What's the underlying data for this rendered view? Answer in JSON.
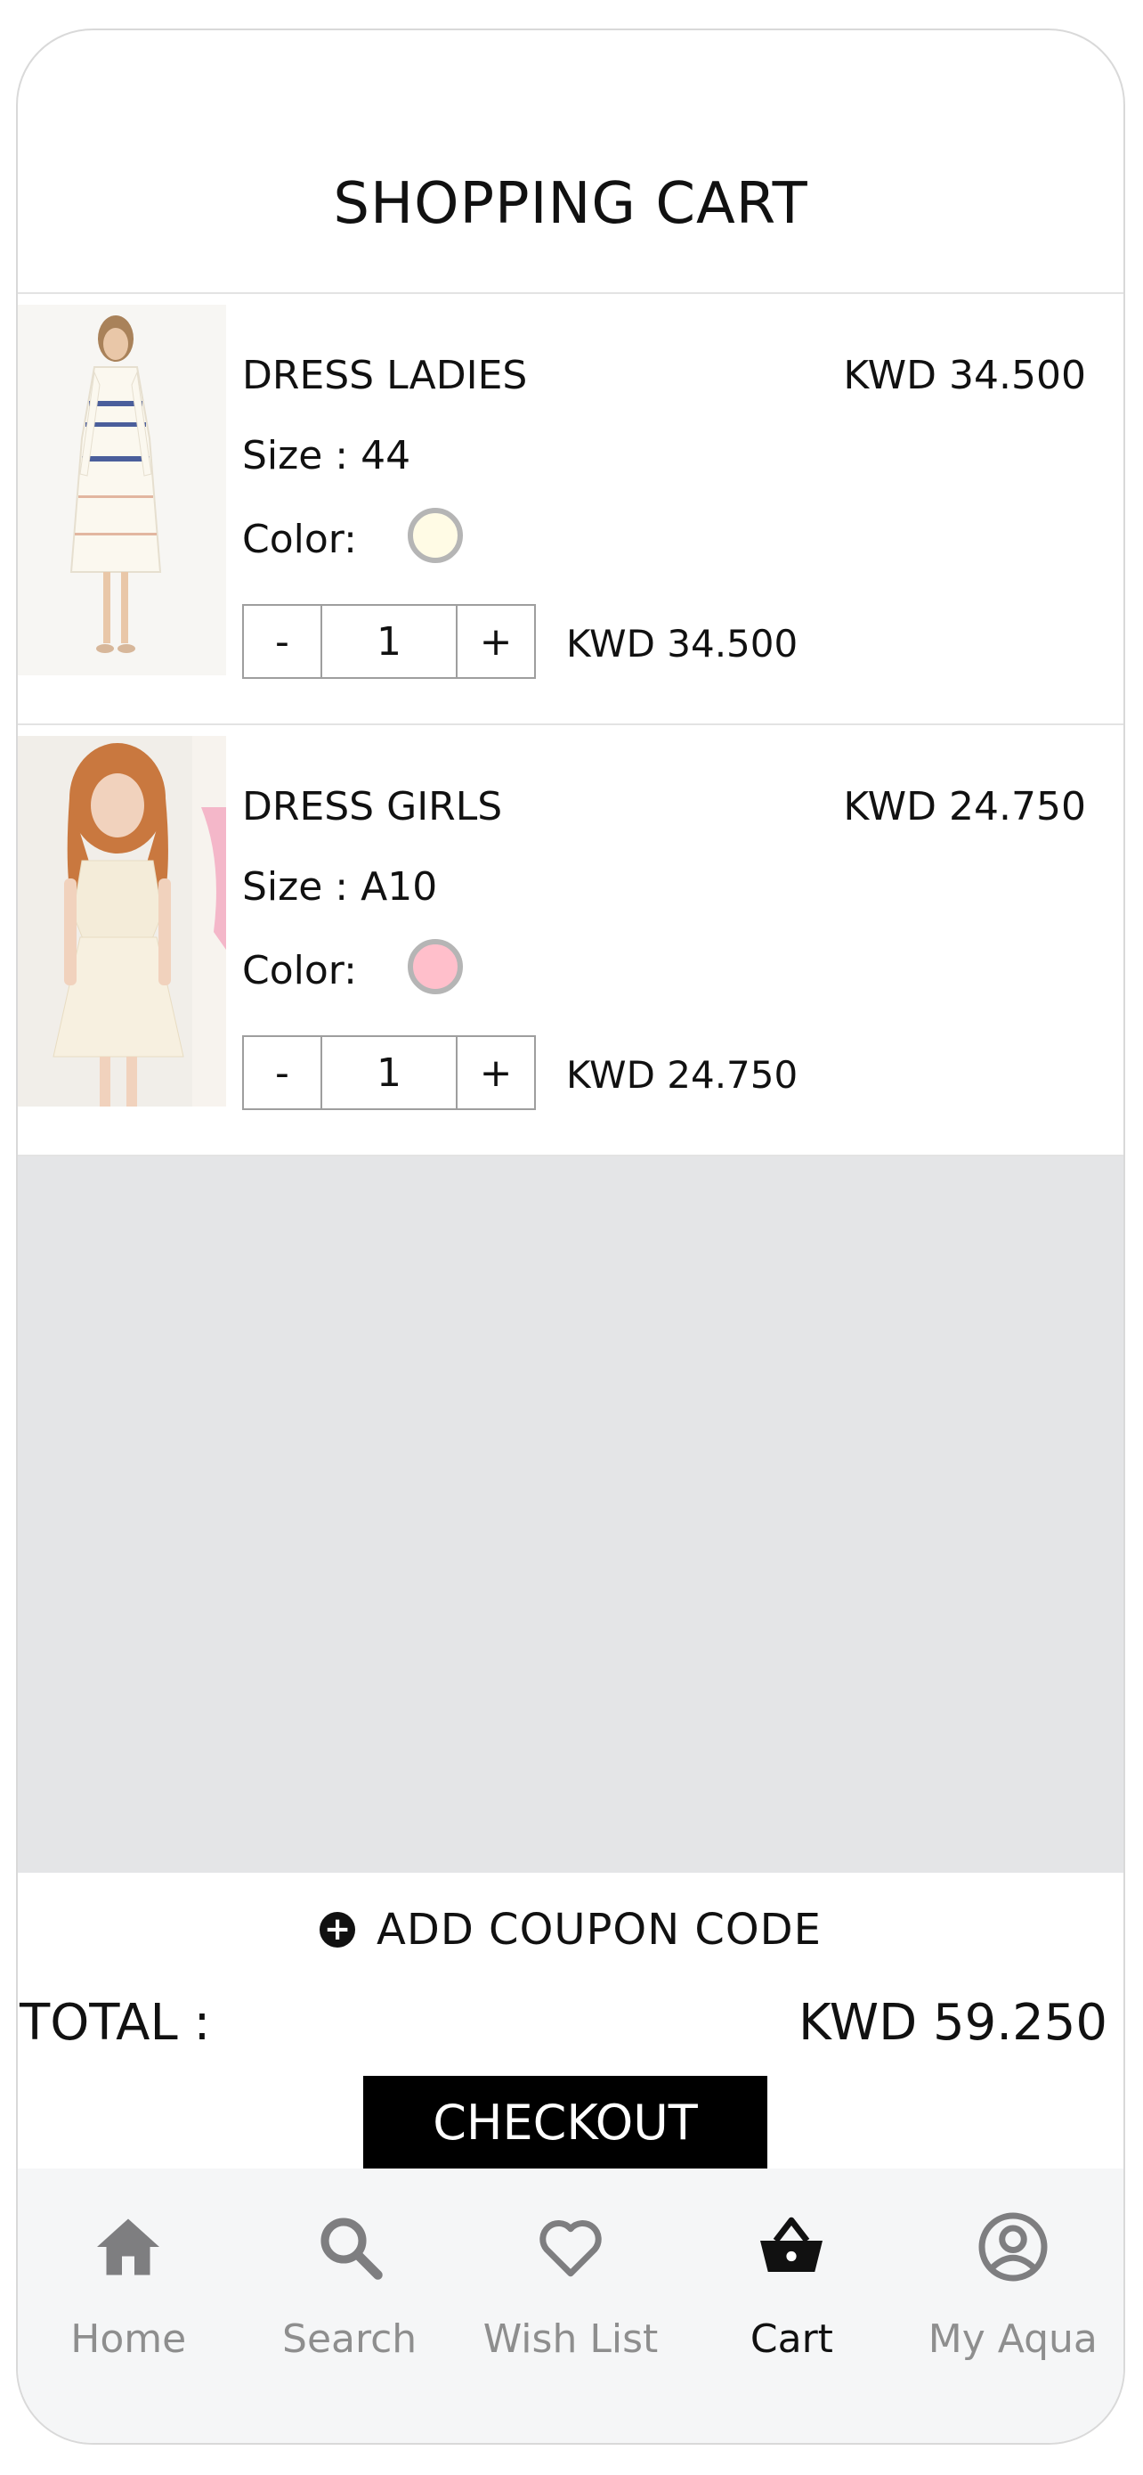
{
  "header": {
    "title": "SHOPPING CART"
  },
  "cart": {
    "items": [
      {
        "name": "DRESS LADIES",
        "price": "KWD 34.500",
        "size": "Size : 44",
        "color_label": "Color:",
        "color_hex": "#fffbe5",
        "qty_minus": "-",
        "quantity": "1",
        "qty_plus": "+",
        "line_total": "KWD 34.500"
      },
      {
        "name": "DRESS GIRLS",
        "price": "KWD 24.750",
        "size": "Size : A10",
        "color_label": "Color:",
        "color_hex": "#ffbfcb",
        "qty_minus": "-",
        "quantity": "1",
        "qty_plus": "+",
        "line_total": "KWD 24.750"
      }
    ]
  },
  "coupon": {
    "label": "ADD COUPON CODE",
    "icon": "plus-circle-icon"
  },
  "summary": {
    "total_label": "TOTAL :",
    "total_value": "KWD 59.250"
  },
  "checkout": {
    "label": "CHECKOUT"
  },
  "tabbar": {
    "tabs": [
      {
        "label": "Home",
        "icon": "home-icon"
      },
      {
        "label": "Search",
        "icon": "search-icon"
      },
      {
        "label": "Wish List",
        "icon": "heart-icon"
      },
      {
        "label": "Cart",
        "icon": "basket-icon"
      },
      {
        "label": "My Aqua",
        "icon": "user-circle-icon"
      }
    ],
    "active": "Cart"
  },
  "colors": {
    "accent": "#000000",
    "tab_inactive": "#8e8e8e",
    "empty_background": "#e4e5e7"
  }
}
